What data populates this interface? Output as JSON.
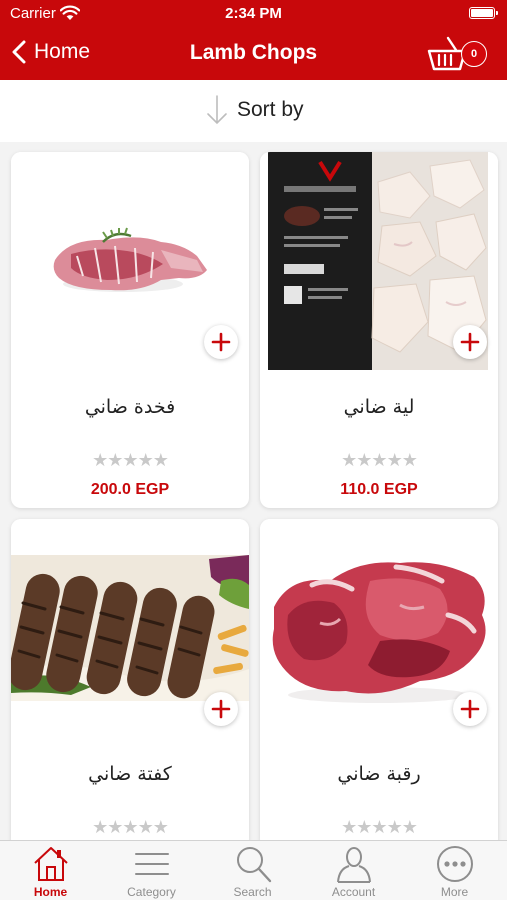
{
  "status_bar": {
    "carrier": "Carrier",
    "time": "2:34 PM"
  },
  "nav": {
    "back_label": "Home",
    "title": "Lamb Chops",
    "cart_count": "0"
  },
  "sort": {
    "label": "Sort by"
  },
  "products": [
    {
      "name": "فخدة ضاني",
      "price": "200.0 EGP",
      "stars": "★★★★★",
      "rating": 0
    },
    {
      "name": "لية ضاني",
      "price": "110.0 EGP",
      "stars": "★★★★★",
      "rating": 0
    },
    {
      "name": "كفتة ضاني",
      "price": "",
      "stars": "★★★★★",
      "rating": 0
    },
    {
      "name": "رقبة ضاني",
      "price": "",
      "stars": "★★★★★",
      "rating": 0
    }
  ],
  "tabs": [
    {
      "label": "Home",
      "icon": "home-icon",
      "active": true
    },
    {
      "label": "Category",
      "icon": "menu-icon",
      "active": false
    },
    {
      "label": "Search",
      "icon": "search-icon",
      "active": false
    },
    {
      "label": "Account",
      "icon": "user-icon",
      "active": false
    },
    {
      "label": "More",
      "icon": "more-icon",
      "active": false
    }
  ],
  "colors": {
    "brand_red": "#c8080b",
    "inactive_gray": "#8e8e8e",
    "star_gray": "#c9c9c9"
  }
}
